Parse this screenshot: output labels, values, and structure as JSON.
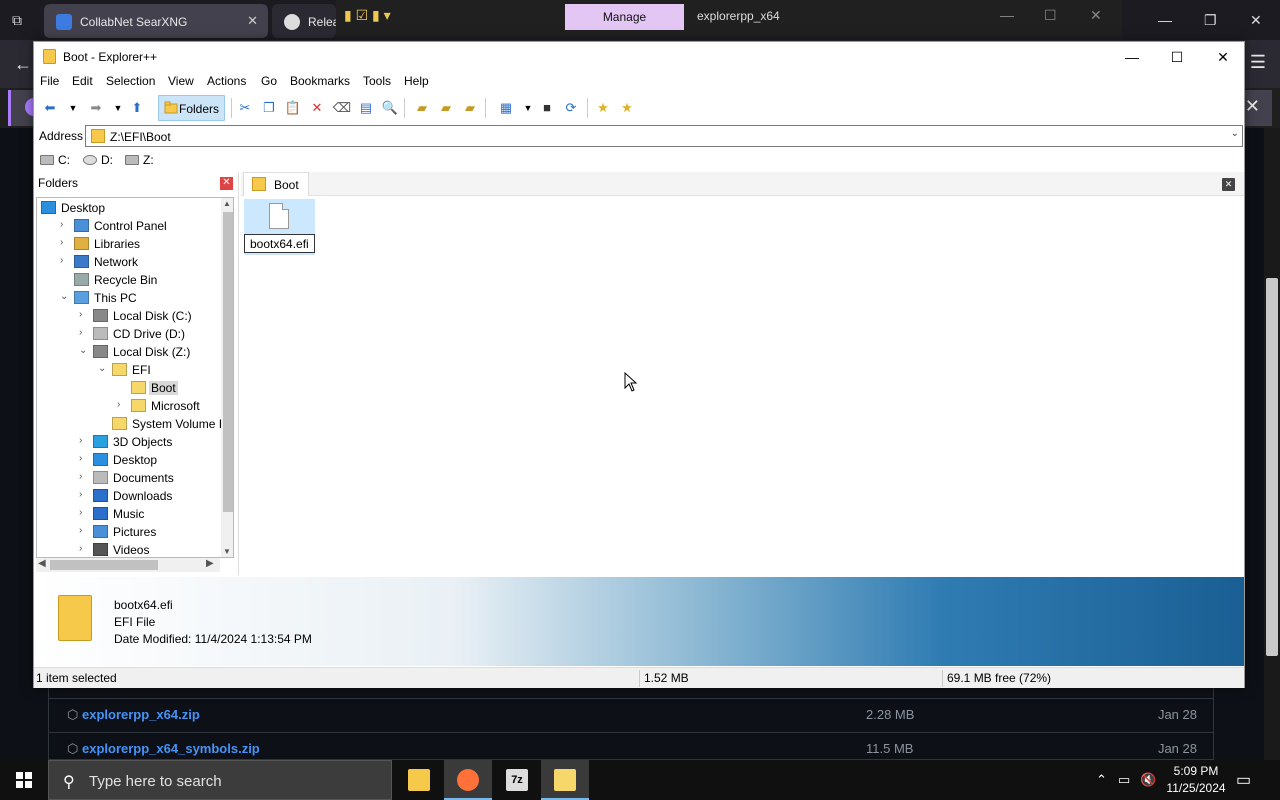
{
  "browser": {
    "tabs": [
      {
        "title": "CollabNet SearXNG",
        "close": "✕"
      },
      {
        "title": "Releas"
      }
    ],
    "back": "←",
    "menu": "☰",
    "info_icon": "i",
    "info_close": "✕"
  },
  "behind_explorer": {
    "manage_label": "Manage",
    "title": "explorerpp_x64"
  },
  "window": {
    "title": "Boot - Explorer++",
    "minimize": "—",
    "maximize": "☐",
    "close": "✕"
  },
  "menubar": [
    "File",
    "Edit",
    "Selection",
    "View",
    "Actions",
    "Go",
    "Bookmarks",
    "Tools",
    "Help"
  ],
  "toolbar": {
    "folders_label": "Folders"
  },
  "address": {
    "label": "Address",
    "value": "Z:\\EFI\\Boot",
    "dropdown": "⌄"
  },
  "drives": [
    "C:",
    "D:",
    "Z:"
  ],
  "folders_pane": {
    "title": "Folders",
    "close": "✕",
    "tree": [
      {
        "label": "Desktop",
        "level": 0,
        "expander": "",
        "icon": "desktop"
      },
      {
        "label": "Control Panel",
        "level": 1,
        "expander": "›",
        "icon": "control-panel"
      },
      {
        "label": "Libraries",
        "level": 1,
        "expander": "›",
        "icon": "libraries"
      },
      {
        "label": "Network",
        "level": 1,
        "expander": "›",
        "icon": "network"
      },
      {
        "label": "Recycle Bin",
        "level": 1,
        "expander": "",
        "icon": "recycle-bin"
      },
      {
        "label": "This PC",
        "level": 1,
        "expander": "⌄",
        "icon": "this-pc"
      },
      {
        "label": "Local Disk (C:)",
        "level": 2,
        "expander": "›",
        "icon": "drive"
      },
      {
        "label": "CD Drive (D:)",
        "level": 2,
        "expander": "›",
        "icon": "cd-drive"
      },
      {
        "label": "Local Disk (Z:)",
        "level": 2,
        "expander": "⌄",
        "icon": "drive"
      },
      {
        "label": "EFI",
        "level": 3,
        "expander": "⌄",
        "icon": "folder"
      },
      {
        "label": "Boot",
        "level": 4,
        "expander": "",
        "icon": "folder",
        "selected": true
      },
      {
        "label": "Microsoft",
        "level": 4,
        "expander": "›",
        "icon": "folder"
      },
      {
        "label": "System Volume Info",
        "level": 3,
        "expander": "",
        "icon": "folder"
      },
      {
        "label": "3D Objects",
        "level": 2,
        "expander": "›",
        "icon": "3d-objects"
      },
      {
        "label": "Desktop",
        "level": 2,
        "expander": "›",
        "icon": "desktop"
      },
      {
        "label": "Documents",
        "level": 2,
        "expander": "›",
        "icon": "documents"
      },
      {
        "label": "Downloads",
        "level": 2,
        "expander": "›",
        "icon": "downloads"
      },
      {
        "label": "Music",
        "level": 2,
        "expander": "›",
        "icon": "music"
      },
      {
        "label": "Pictures",
        "level": 2,
        "expander": "›",
        "icon": "pictures"
      },
      {
        "label": "Videos",
        "level": 2,
        "expander": "›",
        "icon": "videos"
      }
    ]
  },
  "files_pane": {
    "tab_label": "Boot",
    "tab_close": "✕",
    "items": [
      {
        "name": "bootx64.efi",
        "renaming": true
      }
    ]
  },
  "info": {
    "name": "bootx64.efi",
    "type": "EFI File",
    "date_modified": "Date Modified: 11/4/2024 1:13:54 PM"
  },
  "status": {
    "selection": "1 item selected",
    "size": "1.52 MB",
    "free": "69.1 MB free (72%)"
  },
  "webpage": {
    "assets": [
      {
        "name": "explorerpp_x64.zip",
        "size": "2.28 MB",
        "date": "Jan 28"
      },
      {
        "name": "explorerpp_x64_symbols.zip",
        "size": "11.5 MB",
        "date": "Jan 28"
      }
    ]
  },
  "taskbar": {
    "search_placeholder": "Type here to search",
    "time": "5:09 PM",
    "date": "11/25/2024"
  }
}
